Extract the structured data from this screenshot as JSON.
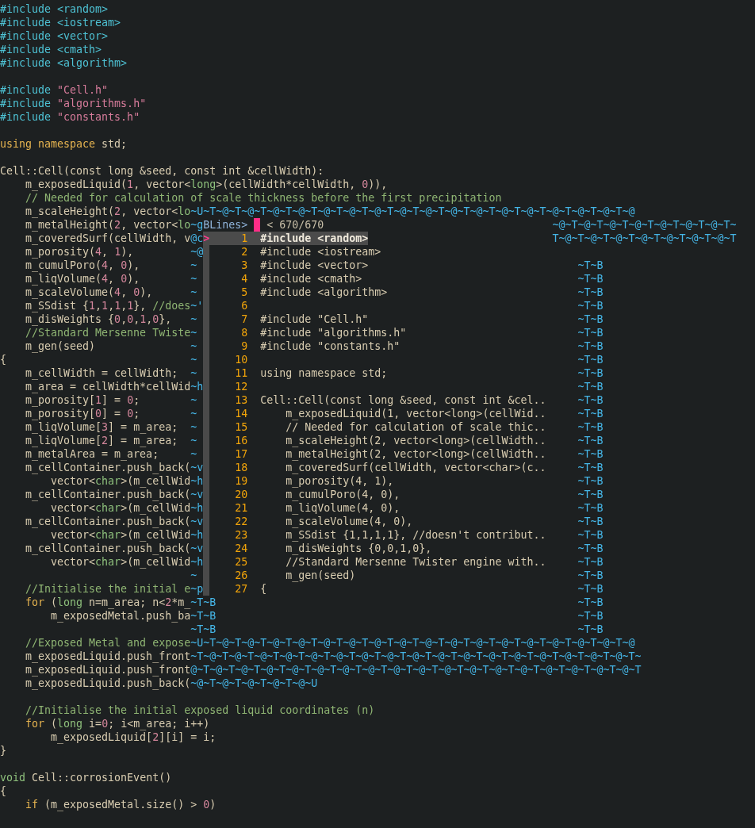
{
  "rows": [
    {
      "kind": "code",
      "segments": [
        {
          "text": "#include <random>",
          "kind": "preproc"
        }
      ]
    },
    {
      "kind": "code",
      "segments": [
        {
          "text": "#include <iostream>",
          "kind": "preproc"
        }
      ]
    },
    {
      "kind": "code",
      "segments": [
        {
          "text": "#include <vector>",
          "kind": "preproc"
        }
      ]
    },
    {
      "kind": "code",
      "segments": [
        {
          "text": "#include <cmath>",
          "kind": "preproc"
        }
      ]
    },
    {
      "kind": "code",
      "segments": [
        {
          "text": "#include <algorithm>",
          "kind": "preproc"
        }
      ]
    },
    {
      "kind": "code"
    },
    {
      "kind": "code",
      "segments": [
        {
          "text": "#include ",
          "kind": "preproc"
        },
        {
          "text": "\"Cell.h\"",
          "kind": "string"
        }
      ]
    },
    {
      "kind": "code",
      "segments": [
        {
          "text": "#include ",
          "kind": "preproc"
        },
        {
          "text": "\"algorithms.h\"",
          "kind": "string"
        }
      ]
    },
    {
      "kind": "code",
      "segments": [
        {
          "text": "#include ",
          "kind": "preproc"
        },
        {
          "text": "\"constants.h\"",
          "kind": "string"
        }
      ]
    },
    {
      "kind": "code"
    },
    {
      "kind": "code",
      "segments": [
        {
          "text": "using namespace",
          "kind": "keyword"
        },
        {
          "text": " std;",
          "kind": "plain"
        }
      ]
    },
    {
      "kind": "code"
    },
    {
      "kind": "code",
      "segments": [
        {
          "text": "Cell::Cell(const long &seed, const int &cellWidth):",
          "kind": "plain"
        }
      ]
    },
    {
      "kind": "code",
      "segments": [
        {
          "text": "    m_exposedLiquid(",
          "kind": "plain"
        },
        {
          "text": "1",
          "kind": "number"
        },
        {
          "text": ", vector<",
          "kind": "plain"
        },
        {
          "text": "long",
          "kind": "type"
        },
        {
          "text": ">(cellWidth*cellWidth, ",
          "kind": "plain"
        },
        {
          "text": "0",
          "kind": "number"
        },
        {
          "text": ")),",
          "kind": "plain"
        }
      ]
    },
    {
      "kind": "code",
      "segments": [
        {
          "text": "    // Needed for calculation of scale thickness before the first precipitation",
          "kind": "comment"
        }
      ]
    },
    {
      "kind": "code",
      "segments": [
        {
          "text": "    m_scaleHeight(",
          "kind": "plain"
        },
        {
          "text": "2",
          "kind": "number"
        },
        {
          "text": ", vector<",
          "kind": "plain"
        },
        {
          "text": "lo",
          "kind": "type"
        },
        {
          "text": "~U~T~@~T~@~T~@~T~@~T~@~T~@~T~@~T~@~T~@~T~@~T~@~T~@~T~@~T~@~T~@~T~@~T~@",
          "kind": "artifact"
        }
      ]
    },
    {
      "kind": "prompt",
      "left": [
        {
          "text": "    m_metalHeight(",
          "kind": "plain"
        },
        {
          "text": "2",
          "kind": "number"
        },
        {
          "text": ", vector<",
          "kind": "plain"
        },
        {
          "text": "lo",
          "kind": "type"
        }
      ],
      "left_artifact": "~g",
      "prompt": "BLines>",
      "counter": "< 670/670",
      "artifact": {
        "text": "~@~T~@~T~@~T~@~T~@~T~@~T~@~T~",
        "kind": "wave"
      }
    },
    {
      "kind": "item",
      "left": [
        {
          "text": "    m_coveredSurf(cellWidth, v",
          "kind": "plain"
        }
      ],
      "left_artifact": "@c",
      "pointer": ">",
      "number": "1",
      "text": "#include <random>",
      "selected": true,
      "artifact": {
        "text": "T~@~T~@~T~@~T~@~T~@~T~@~T~@~T",
        "kind": "wave"
      }
    },
    {
      "kind": "item",
      "left": [
        {
          "text": "    m_porosity(",
          "kind": "plain"
        },
        {
          "text": "4",
          "kind": "number"
        },
        {
          "text": ", ",
          "kind": "plain"
        },
        {
          "text": "1",
          "kind": "number"
        },
        {
          "text": "),",
          "kind": "plain"
        }
      ],
      "left_artifact": "~@",
      "number": "2",
      "text": "#include <iostream>",
      "selected": false
    },
    {
      "kind": "item",
      "left": [
        {
          "text": "    m_cumulPoro(",
          "kind": "plain"
        },
        {
          "text": "4",
          "kind": "number"
        },
        {
          "text": ", ",
          "kind": "plain"
        },
        {
          "text": "0",
          "kind": "number"
        },
        {
          "text": "),",
          "kind": "plain"
        }
      ],
      "left_artifact": "~",
      "number": "3",
      "text": "#include <vector>",
      "selected": false,
      "artifact": {
        "text": "~T~B",
        "kind": "tb"
      }
    },
    {
      "kind": "item",
      "left": [
        {
          "text": "    m_liqVolume(",
          "kind": "plain"
        },
        {
          "text": "4",
          "kind": "number"
        },
        {
          "text": ", ",
          "kind": "plain"
        },
        {
          "text": "0",
          "kind": "number"
        },
        {
          "text": "),",
          "kind": "plain"
        }
      ],
      "left_artifact": "~",
      "number": "4",
      "text": "#include <cmath>",
      "selected": false,
      "artifact": {
        "text": "~T~B",
        "kind": "tb"
      }
    },
    {
      "kind": "item",
      "left": [
        {
          "text": "    m_scaleVolume(",
          "kind": "plain"
        },
        {
          "text": "4",
          "kind": "number"
        },
        {
          "text": ", ",
          "kind": "plain"
        },
        {
          "text": "0",
          "kind": "number"
        },
        {
          "text": "),",
          "kind": "plain"
        }
      ],
      "left_artifact": "~",
      "number": "5",
      "text": "#include <algorithm>",
      "selected": false,
      "artifact": {
        "text": "~T~B",
        "kind": "tb"
      }
    },
    {
      "kind": "item",
      "left": [
        {
          "text": "    m_SSdist {",
          "kind": "plain"
        },
        {
          "text": "1",
          "kind": "number"
        },
        {
          "text": ",",
          "kind": "plain"
        },
        {
          "text": "1",
          "kind": "number"
        },
        {
          "text": ",",
          "kind": "plain"
        },
        {
          "text": "1",
          "kind": "number"
        },
        {
          "text": ",",
          "kind": "plain"
        },
        {
          "text": "1",
          "kind": "number"
        },
        {
          "text": "}, ",
          "kind": "plain"
        },
        {
          "text": "//does",
          "kind": "comment"
        }
      ],
      "left_artifact": "~'",
      "number": "6",
      "selected": false,
      "artifact": {
        "text": "~T~B",
        "kind": "tb"
      }
    },
    {
      "kind": "item",
      "left": [
        {
          "text": "    m_disWeights {",
          "kind": "plain"
        },
        {
          "text": "0",
          "kind": "number"
        },
        {
          "text": ",",
          "kind": "plain"
        },
        {
          "text": "0",
          "kind": "number"
        },
        {
          "text": ",",
          "kind": "plain"
        },
        {
          "text": "1",
          "kind": "number"
        },
        {
          "text": ",",
          "kind": "plain"
        },
        {
          "text": "0",
          "kind": "number"
        },
        {
          "text": "},",
          "kind": "plain"
        }
      ],
      "left_artifact": "~",
      "number": "7",
      "text": "#include \"Cell.h\"",
      "selected": false,
      "artifact": {
        "text": "~T~B",
        "kind": "tb"
      }
    },
    {
      "kind": "item",
      "left": [
        {
          "text": "    //Standard Mersenne Twiste",
          "kind": "comment"
        }
      ],
      "left_artifact": "~",
      "number": "8",
      "text": "#include \"algorithms.h\"",
      "selected": false,
      "artifact": {
        "text": "~T~B",
        "kind": "tb"
      }
    },
    {
      "kind": "item",
      "left": [
        {
          "text": "    m_gen(seed)",
          "kind": "plain"
        }
      ],
      "left_artifact": "~",
      "number": "9",
      "text": "#include \"constants.h\"",
      "selected": false,
      "artifact": {
        "text": "~T~B",
        "kind": "tb"
      }
    },
    {
      "kind": "item",
      "left": [
        {
          "text": "{",
          "kind": "plain"
        }
      ],
      "left_artifact": "~",
      "number": "10",
      "selected": false,
      "artifact": {
        "text": "~T~B",
        "kind": "tb"
      }
    },
    {
      "kind": "item",
      "left": [
        {
          "text": "    m_cellWidth = cellWidth;",
          "kind": "plain"
        }
      ],
      "left_artifact": "~",
      "number": "11",
      "text": "using namespace std;",
      "selected": false,
      "artifact": {
        "text": "~T~B",
        "kind": "tb"
      }
    },
    {
      "kind": "item",
      "left": [
        {
          "text": "    m_area = cellWidth*cellWid",
          "kind": "plain"
        }
      ],
      "left_artifact": "~h",
      "number": "12",
      "selected": false,
      "artifact": {
        "text": "~T~B",
        "kind": "tb"
      }
    },
    {
      "kind": "item",
      "left": [
        {
          "text": "    m_porosity[",
          "kind": "plain"
        },
        {
          "text": "1",
          "kind": "number"
        },
        {
          "text": "] = ",
          "kind": "plain"
        },
        {
          "text": "0",
          "kind": "number"
        },
        {
          "text": ";",
          "kind": "plain"
        }
      ],
      "left_artifact": "~",
      "number": "13",
      "text": "Cell::Cell(const long &seed, const int &cel..",
      "selected": false,
      "artifact": {
        "text": "~T~B",
        "kind": "tb"
      }
    },
    {
      "kind": "item",
      "left": [
        {
          "text": "    m_porosity[",
          "kind": "plain"
        },
        {
          "text": "0",
          "kind": "number"
        },
        {
          "text": "] = ",
          "kind": "plain"
        },
        {
          "text": "0",
          "kind": "number"
        },
        {
          "text": ";",
          "kind": "plain"
        }
      ],
      "left_artifact": "~",
      "number": "14",
      "text": "    m_exposedLiquid(1, vector<long>(cellWid..",
      "selected": false,
      "artifact": {
        "text": "~T~B",
        "kind": "tb"
      }
    },
    {
      "kind": "item",
      "left": [
        {
          "text": "    m_liqVolume[",
          "kind": "plain"
        },
        {
          "text": "3",
          "kind": "number"
        },
        {
          "text": "] = m_area;",
          "kind": "plain"
        }
      ],
      "left_artifact": "~",
      "number": "15",
      "text": "    // Needed for calculation of scale thic..",
      "selected": false,
      "artifact": {
        "text": "~T~B",
        "kind": "tb"
      }
    },
    {
      "kind": "item",
      "left": [
        {
          "text": "    m_liqVolume[",
          "kind": "plain"
        },
        {
          "text": "2",
          "kind": "number"
        },
        {
          "text": "] = m_area;",
          "kind": "plain"
        }
      ],
      "left_artifact": "~",
      "number": "16",
      "text": "    m_scaleHeight(2, vector<long>(cellWidth..",
      "selected": false,
      "artifact": {
        "text": "~T~B",
        "kind": "tb"
      }
    },
    {
      "kind": "item",
      "left": [
        {
          "text": "    m_metalArea = m_area;",
          "kind": "plain"
        }
      ],
      "left_artifact": "~",
      "number": "17",
      "text": "    m_metalHeight(2, vector<long>(cellWidth..",
      "selected": false,
      "artifact": {
        "text": "~T~B",
        "kind": "tb"
      }
    },
    {
      "kind": "item",
      "left": [
        {
          "text": "    m_cellContainer.push_back(",
          "kind": "plain"
        }
      ],
      "left_artifact": "~v",
      "number": "18",
      "text": "    m_coveredSurf(cellWidth, vector<char>(c..",
      "selected": false,
      "artifact": {
        "text": "~T~B",
        "kind": "tb"
      }
    },
    {
      "kind": "item",
      "left": [
        {
          "text": "        vector<",
          "kind": "plain"
        },
        {
          "text": "char",
          "kind": "type"
        },
        {
          "text": ">(m_cellWid",
          "kind": "plain"
        }
      ],
      "left_artifact": "~h",
      "number": "19",
      "text": "    m_porosity(4, 1),",
      "selected": false,
      "artifact": {
        "text": "~T~B",
        "kind": "tb"
      }
    },
    {
      "kind": "item",
      "left": [
        {
          "text": "    m_cellContainer.push_back(",
          "kind": "plain"
        }
      ],
      "left_artifact": "~v",
      "number": "20",
      "text": "    m_cumulPoro(4, 0),",
      "selected": false,
      "artifact": {
        "text": "~T~B",
        "kind": "tb"
      }
    },
    {
      "kind": "item",
      "left": [
        {
          "text": "        vector<",
          "kind": "plain"
        },
        {
          "text": "char",
          "kind": "type"
        },
        {
          "text": ">(m_cellWid",
          "kind": "plain"
        }
      ],
      "left_artifact": "~h",
      "number": "21",
      "text": "    m_liqVolume(4, 0),",
      "selected": false,
      "artifact": {
        "text": "~T~B",
        "kind": "tb"
      }
    },
    {
      "kind": "item",
      "left": [
        {
          "text": "    m_cellContainer.push_back(",
          "kind": "plain"
        }
      ],
      "left_artifact": "~v",
      "number": "22",
      "text": "    m_scaleVolume(4, 0),",
      "selected": false,
      "artifact": {
        "text": "~T~B",
        "kind": "tb"
      }
    },
    {
      "kind": "item",
      "left": [
        {
          "text": "        vector<",
          "kind": "plain"
        },
        {
          "text": "char",
          "kind": "type"
        },
        {
          "text": ">(m_cellWid",
          "kind": "plain"
        }
      ],
      "left_artifact": "~h",
      "number": "23",
      "text": "    m_SSdist {1,1,1,1}, //doesn't contribut..",
      "selected": false,
      "artifact": {
        "text": "~T~B",
        "kind": "tb"
      }
    },
    {
      "kind": "item",
      "left": [
        {
          "text": "    m_cellContainer.push_back(",
          "kind": "plain"
        }
      ],
      "left_artifact": "~v",
      "number": "24",
      "text": "    m_disWeights {0,0,1,0},",
      "selected": false,
      "artifact": {
        "text": "~T~B",
        "kind": "tb"
      }
    },
    {
      "kind": "item",
      "left": [
        {
          "text": "        vector<",
          "kind": "plain"
        },
        {
          "text": "char",
          "kind": "type"
        },
        {
          "text": ">(m_cellWid",
          "kind": "plain"
        }
      ],
      "left_artifact": "~h",
      "number": "25",
      "text": "    //Standard Mersenne Twister engine with..",
      "selected": false,
      "artifact": {
        "text": "~T~B",
        "kind": "tb"
      }
    },
    {
      "kind": "item",
      "left_artifact": "~",
      "number": "26",
      "text": "    m_gen(seed)",
      "selected": false,
      "artifact": {
        "text": "~T~B",
        "kind": "tb"
      }
    },
    {
      "kind": "item",
      "left": [
        {
          "text": "    //Initialise the initial e",
          "kind": "comment"
        }
      ],
      "left_artifact": "~p",
      "number": "27",
      "text": "{",
      "selected": false,
      "artifact": {
        "text": "~T~B",
        "kind": "tb"
      }
    },
    {
      "kind": "tail",
      "left": [
        {
          "text": "    for",
          "kind": "keyword"
        },
        {
          "text": " (",
          "kind": "plain"
        },
        {
          "text": "long",
          "kind": "type"
        },
        {
          "text": " n=m_area; n<",
          "kind": "plain"
        },
        {
          "text": "2",
          "kind": "number"
        },
        {
          "text": "*m_",
          "kind": "plain"
        }
      ],
      "left_artifact": "~T~B",
      "artifact": {
        "text": "~T~B",
        "kind": "tb"
      }
    },
    {
      "kind": "tail",
      "left": [
        {
          "text": "        m_exposedMetal.push_ba",
          "kind": "plain"
        }
      ],
      "left_artifact": "~T~B",
      "artifact": {
        "text": "~T~B",
        "kind": "tb"
      }
    },
    {
      "kind": "tail",
      "left_artifact": "~T~B",
      "artifact": {
        "text": "~T~B",
        "kind": "tb"
      }
    },
    {
      "kind": "code",
      "segments": [
        {
          "text": "    //Exposed Metal and expose",
          "kind": "comment"
        },
        {
          "text": "~U~T~@~T~@~T~@~T~@~T~@~T~@~T~@~T~@~T~@~T~@~T~@~T~@~T~@~T~@~T~@~T~@~T~@",
          "kind": "artifact"
        }
      ]
    },
    {
      "kind": "code",
      "segments": [
        {
          "text": "    m_exposedLiquid.push_front",
          "kind": "plain"
        },
        {
          "text": "~T~@~T~@~T~@~T~@~T~@~T~@~T~@~T~@~T~@~T~@~T~@~T~@~T~@~T~@~T~@~T~@~T~@~T~",
          "kind": "artifact"
        }
      ]
    },
    {
      "kind": "code",
      "segments": [
        {
          "text": "    m_exposedLiquid.push_front",
          "kind": "plain"
        },
        {
          "text": "@~T~@~T~@~T~@~T~@~T~@~T~@~T~@~T~@~T~@~T~@~T~@~T~@~T~@~T~@~T~@~T~@~T~@~T",
          "kind": "artifact"
        }
      ]
    },
    {
      "kind": "code",
      "segments": [
        {
          "text": "    m_exposedLiquid.push_back(",
          "kind": "plain"
        },
        {
          "text": "~@~T~@~T~@~T~@~T~@~U",
          "kind": "artifact"
        }
      ]
    },
    {
      "kind": "code"
    },
    {
      "kind": "code",
      "segments": [
        {
          "text": "    //Initialise the initial exposed liquid coordinates (n)",
          "kind": "comment"
        }
      ]
    },
    {
      "kind": "code",
      "segments": [
        {
          "text": "    for",
          "kind": "keyword"
        },
        {
          "text": " (",
          "kind": "plain"
        },
        {
          "text": "long",
          "kind": "type"
        },
        {
          "text": " i=",
          "kind": "plain"
        },
        {
          "text": "0",
          "kind": "number"
        },
        {
          "text": "; i<m_area; i++)",
          "kind": "plain"
        }
      ]
    },
    {
      "kind": "code",
      "segments": [
        {
          "text": "        m_exposedLiquid[",
          "kind": "plain"
        },
        {
          "text": "2",
          "kind": "number"
        },
        {
          "text": "][i] = i;",
          "kind": "plain"
        }
      ]
    },
    {
      "kind": "code",
      "segments": [
        {
          "text": "}",
          "kind": "plain"
        }
      ]
    },
    {
      "kind": "code"
    },
    {
      "kind": "code",
      "segments": [
        {
          "text": "void",
          "kind": "type"
        },
        {
          "text": " Cell::corrosionEvent()",
          "kind": "plain"
        }
      ]
    },
    {
      "kind": "code",
      "segments": [
        {
          "text": "{",
          "kind": "plain"
        }
      ]
    },
    {
      "kind": "code",
      "segments": [
        {
          "text": "    if",
          "kind": "keyword"
        },
        {
          "text": " (m_exposedMetal.size() > ",
          "kind": "plain"
        },
        {
          "text": "0",
          "kind": "number"
        },
        {
          "text": ")",
          "kind": "plain"
        }
      ]
    }
  ]
}
